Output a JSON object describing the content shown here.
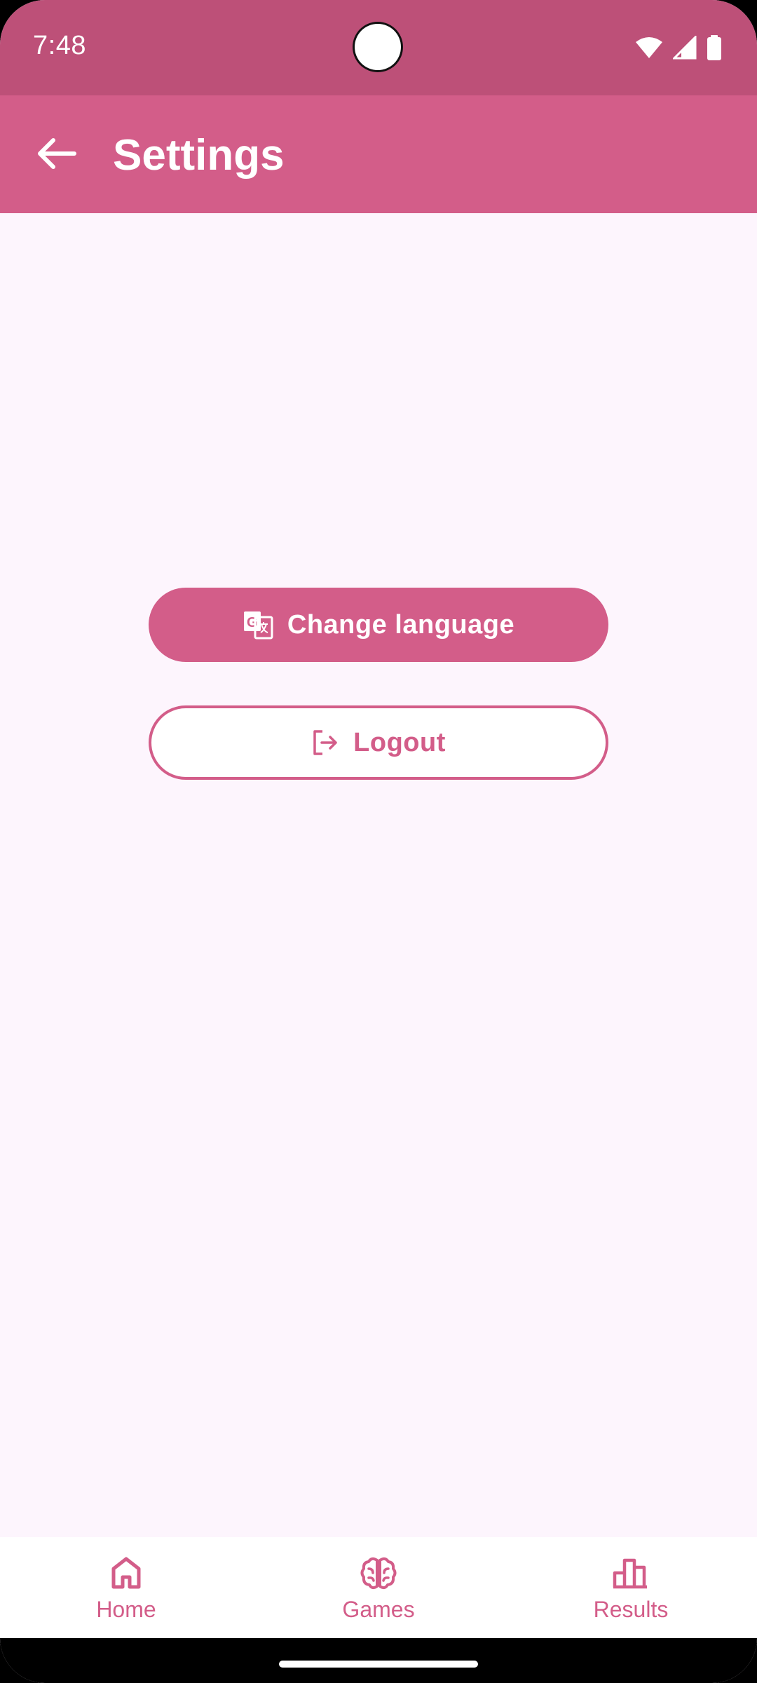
{
  "status_bar": {
    "time": "7:48",
    "icons": [
      "wifi-icon",
      "signal-icon",
      "battery-icon"
    ]
  },
  "app_bar": {
    "title": "Settings",
    "back_icon": "arrow-left-icon"
  },
  "actions": {
    "change_language": {
      "label": "Change language",
      "icon": "translate-icon"
    },
    "logout": {
      "label": "Logout",
      "icon": "logout-icon"
    }
  },
  "bottom_nav": {
    "items": [
      {
        "label": "Home",
        "icon": "home-icon"
      },
      {
        "label": "Games",
        "icon": "brain-icon"
      },
      {
        "label": "Results",
        "icon": "bar-chart-icon"
      }
    ]
  },
  "colors": {
    "status_bar": "#bd5078",
    "app_bar": "#d35d89",
    "accent": "#d35d89",
    "background": "#fdf5fd"
  }
}
